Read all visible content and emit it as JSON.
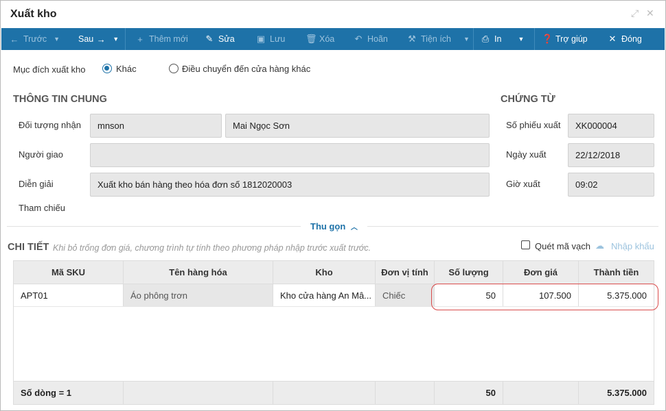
{
  "window": {
    "title": "Xuất kho"
  },
  "toolbar": {
    "prev": "Trước",
    "next": "Sau",
    "add": "Thêm mới",
    "edit": "Sửa",
    "save": "Lưu",
    "delete": "Xóa",
    "undo": "Hoãn",
    "utility": "Tiện ích",
    "print": "In",
    "help": "Trợ giúp",
    "close": "Đóng"
  },
  "purpose": {
    "label": "Mục đích xuất kho",
    "options": [
      "Khác",
      "Điều chuyển đến cửa hàng khác"
    ],
    "selected": "Khác"
  },
  "general": {
    "title": "THÔNG TIN CHUNG",
    "recipient_label": "Đối tượng nhận",
    "recipient_code": "mnson",
    "recipient_name": "Mai Ngọc Sơn",
    "deliverer_label": "Người giao",
    "deliverer_value": "",
    "description_label": "Diễn giải",
    "description_value": "Xuất kho bán hàng theo hóa đơn số 1812020003",
    "reference_label": "Tham chiếu"
  },
  "voucher": {
    "title": "CHỨNG TỪ",
    "number_label": "Số phiếu xuất",
    "number_value": "XK000004",
    "date_label": "Ngày xuất",
    "date_value": "22/12/2018",
    "time_label": "Giờ xuất",
    "time_value": "09:02"
  },
  "collapse_label": "Thu gọn",
  "detail": {
    "title": "CHI TIẾT",
    "hint": "Khi bỏ trống đơn giá, chương trình tự tính theo phương pháp nhập trước xuất trước.",
    "barcode_label": "Quét mã vạch",
    "import_label": "Nhập khẩu",
    "columns": [
      "Mã SKU",
      "Tên hàng hóa",
      "Kho",
      "Đơn vị tính",
      "Số lượng",
      "Đơn giá",
      "Thành tiền"
    ],
    "rows": [
      {
        "sku": "APT01",
        "name": "Áo phông trơn",
        "warehouse": "Kho cửa hàng An Mâ...",
        "unit": "Chiếc",
        "qty": "50",
        "price": "107.500",
        "amount": "5.375.000"
      }
    ],
    "footer": {
      "row_count": "Số dòng = 1",
      "qty_total": "50",
      "amount_total": "5.375.000"
    }
  },
  "colors": {
    "toolbar": "#1e72a8",
    "accent": "#1e72a8",
    "highlight": "#d94b4b"
  }
}
